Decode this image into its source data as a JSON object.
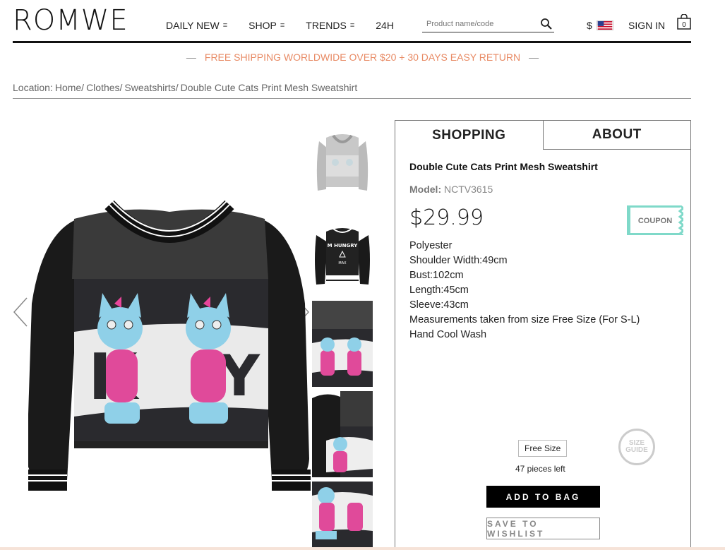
{
  "header": {
    "logo": "ROMWE",
    "nav": [
      "DAILY NEW",
      "SHOP",
      "TRENDS",
      "24H"
    ],
    "search_placeholder": "Product name/code",
    "currency": "$",
    "signin": "SIGN IN",
    "bag_count": "0"
  },
  "promo": "FREE SHIPPING WORLDWIDE OVER $20 + 30 DAYS EASY RETURN",
  "breadcrumb": {
    "label": "Location:",
    "items": [
      "Home/",
      "Clothes/",
      "Sweatshirts/",
      "Double Cute Cats Print Mesh Sweatshirt"
    ]
  },
  "panel": {
    "tabs": [
      "SHOPPING",
      "ABOUT"
    ],
    "title": "Double Cute Cats Print Mesh Sweatshirt",
    "model_label": "Model:",
    "model_value": "NCTV3615",
    "price": "$29.99",
    "coupon": "COUPON",
    "description": [
      "Polyester",
      "Shoulder Width:49cm",
      "Bust:102cm",
      "Length:45cm",
      "Sleeve:43cm",
      "Measurements taken from size Free Size (For S-L)",
      "Hand Cool Wash"
    ],
    "size": "Free Size",
    "pieces_left": "47 pieces left",
    "size_guide": [
      "SIZE",
      "GUIDE"
    ],
    "add_to_bag": "ADD TO BAG",
    "save_wishlist": "SAVE TO WISHLIST"
  },
  "colors": {
    "accent": "#e88a64",
    "coupon": "#7fd9c9"
  }
}
